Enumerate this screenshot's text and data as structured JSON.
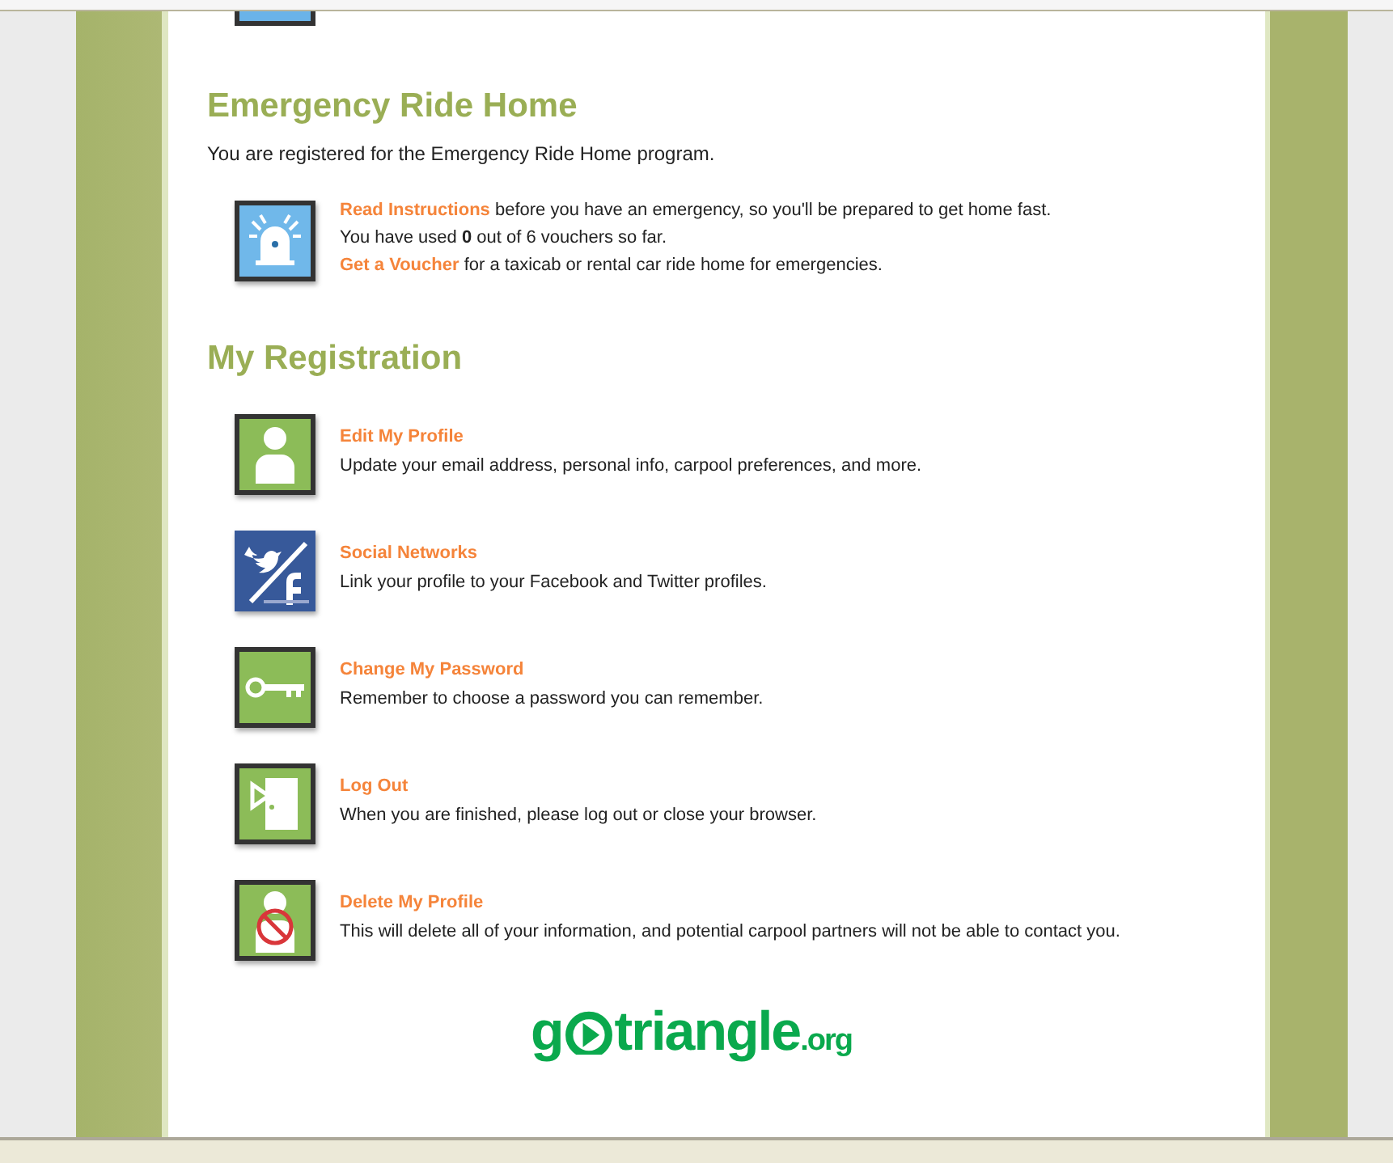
{
  "emergency": {
    "title": "Emergency Ride Home",
    "intro": "You are registered for the Emergency Ride Home program.",
    "lines": [
      {
        "link": "Read Instructions",
        "text": " before you have an emergency, so you'll be prepared to get home fast."
      },
      {
        "text": "You have used **0** out of 6 vouchers so far."
      },
      {
        "link": "Get a Voucher",
        "text": " for a taxicab or rental car ride home for emergencies."
      }
    ]
  },
  "registration": {
    "title": "My Registration",
    "items": [
      {
        "kind": "person",
        "link": "Edit My Profile",
        "text": "Update your email address, personal info, carpool preferences, and more."
      },
      {
        "kind": "social",
        "link": "Social Networks",
        "text": "Link your profile to your Facebook and Twitter profiles."
      },
      {
        "kind": "key",
        "link": "Change My Password",
        "text": "Remember to choose a password you can remember."
      },
      {
        "kind": "door",
        "link": "Log Out",
        "text": "When you are finished, please log out or close your browser."
      },
      {
        "kind": "delete",
        "link": "Delete My Profile",
        "text": "This will delete all of your information, and potential carpool partners will not be able to contact you."
      }
    ]
  },
  "logo": {
    "before": "g",
    "after": "triangle",
    "suffix": ".org"
  }
}
